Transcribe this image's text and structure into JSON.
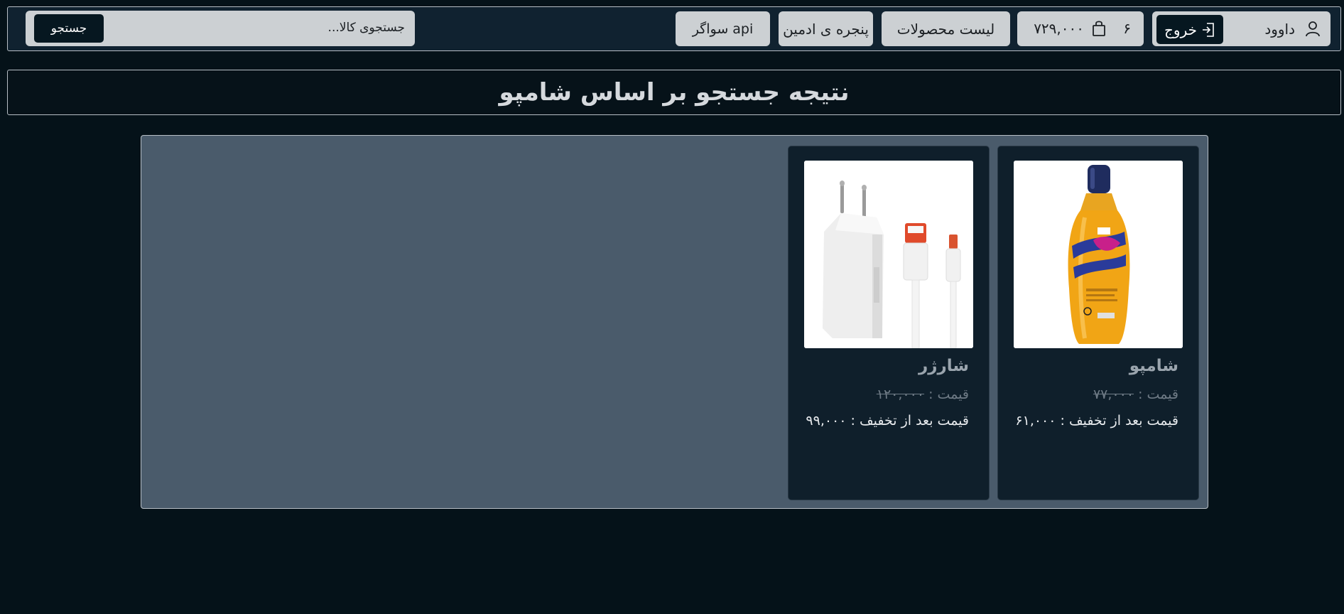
{
  "navbar": {
    "user": {
      "name": "داوود",
      "icon": "user-icon"
    },
    "logout_label": "خروج",
    "cart": {
      "count": "۶",
      "total": "۷۲۹,۰۰۰",
      "icon": "shopping-bag-icon"
    },
    "products_label": "لیست محصولات",
    "admin_label": "پنجره ی ادمین",
    "swagger_label": "سواگر api",
    "search": {
      "placeholder": "جستجوی کالا...",
      "button_label": "جستجو"
    }
  },
  "page": {
    "title": "نتیجه جستجو بر اساس شامپو"
  },
  "products": [
    {
      "name": "شامپو",
      "price_label": "قیمت :",
      "price": "۷۷,۰۰۰",
      "final_label": "قیمت بعد از تخفیف :",
      "final_price": "۶۱,۰۰۰",
      "image": "shampoo-bottle"
    },
    {
      "name": "شارژر",
      "price_label": "قیمت :",
      "price": "۱۲۰,۰۰۰",
      "final_label": "قیمت بعد از تخفیف :",
      "final_price": "۹۹,۰۰۰",
      "image": "charger-with-cables"
    }
  ],
  "colors": {
    "background": "#051219",
    "navbar": "#102230",
    "pill": "#ccd0d3",
    "dark_button": "#061720",
    "panel": "#4a5b6b",
    "card": "#0f1f2b"
  }
}
